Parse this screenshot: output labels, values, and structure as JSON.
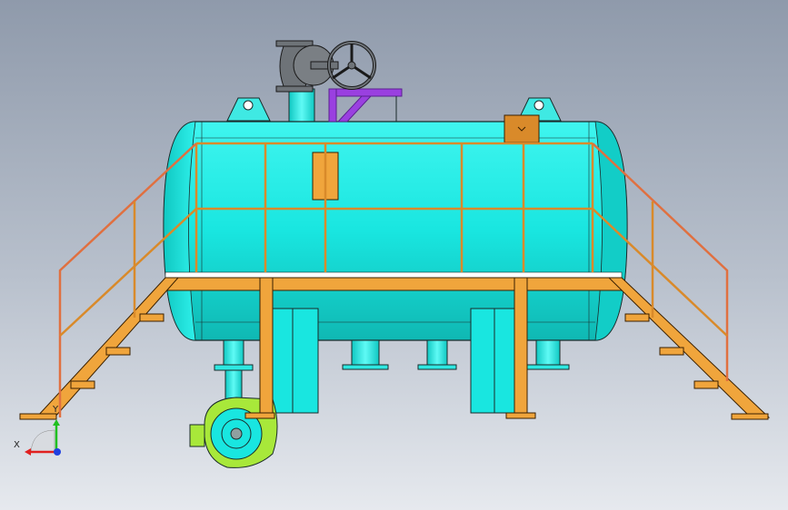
{
  "view": {
    "background_top": "#8f9aab",
    "background_bottom": "#e6e9ee"
  },
  "model": {
    "tank_color": "#19e6e0",
    "platform_color": "#f0a53c",
    "handrail_color": "#e07040",
    "valve_color": "#6e7378",
    "vent_pipe_color": "#9a40e0",
    "pump_color": "#a8e83a",
    "parts": [
      "horizontal-tank",
      "work-platform",
      "stairs-left",
      "stairs-right",
      "handwheel-valve",
      "vent-pipe",
      "centrifugal-pump"
    ]
  },
  "triad": {
    "x_label": "X",
    "y_label": "Y",
    "x_color": "#e02020",
    "y_color": "#20c020",
    "z_color": "#2040e0"
  }
}
